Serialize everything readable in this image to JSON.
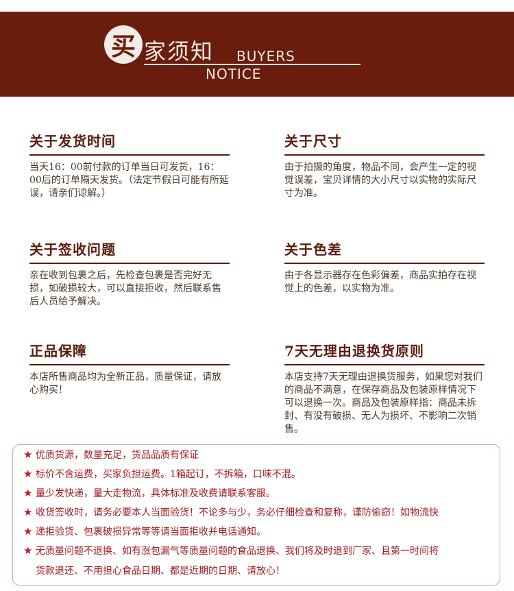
{
  "header": {
    "badge_char": "买",
    "title_rest": "家须知",
    "english_line1": "BUYERS",
    "english_line2": "NOTICE"
  },
  "sections": [
    {
      "title": "关于发货时间",
      "text": "当天16：00前付款的订单当日可发货，16：00后的订单隔天发货。（法定节假日可能有所延误，请亲们谅解。）"
    },
    {
      "title": "关于尺寸",
      "text": "由于拍摄的角度，物品不同，会产生一定的视觉误差，宝贝详情的大小尺寸以实物的实际尺寸为准。"
    },
    {
      "title": "关于签收问题",
      "text": "亲在收到包裹之后，先检查包裹是否完好无损，如破损较大，可以直接拒收，然后联系售后人员给予解决。"
    },
    {
      "title": "关于色差",
      "text": "由于各显示器存在色彩偏差，商品实拍存在视觉上的色差，以实物为准。"
    },
    {
      "title": "正品保障",
      "text": "本店所售商品均为全新正品，质量保证，请放心购买！"
    },
    {
      "title": "7天无理由退换货原则",
      "text": "本店支持7天无理由退换货服务，如果您对我们的商品不满意，在保存商品及包装原样情况下可以退换一次。商品及包装原样指：商品未拆封、有没有破损、无人为损坏、不影响二次销售。"
    }
  ],
  "notices": [
    "优质货源，数量充足，货品品质有保证",
    "标价不含运费，买家负担运费。1箱起订，不拆箱，口味不混。",
    "量少发快递，量大走物流，具体标准及收费请联系客服。",
    "收货签收时，请务必要本人当面验货！不论多与少，务必仔细检查和复称，谨防偷窃！如物流快",
    "递拒验货、包裹破损异常等等请当面拒收并电话通知。",
    "无质量问题不退换、如有涨包漏气等质量问题的食品退换、我们将及时退到厂家、且第一时间将",
    "货款退还、不用担心食品日期、都是近期的日期、请放心！"
  ],
  "colors": {
    "brand": "#6a1d0c",
    "notice_red": "#a21a22"
  }
}
